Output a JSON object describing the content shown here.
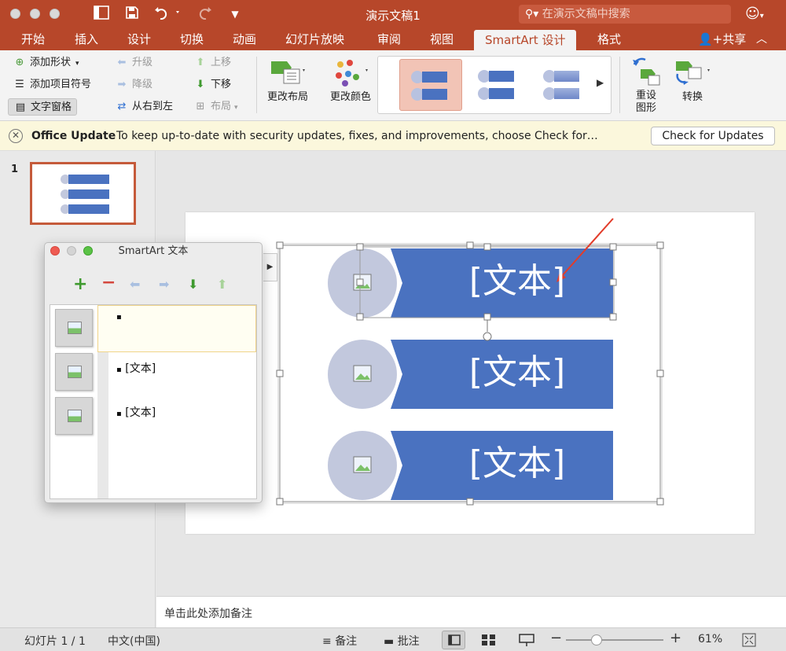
{
  "window": {
    "title": "演示文稿1",
    "search_placeholder": "在演示文稿中搜索"
  },
  "tabs": [
    {
      "label": "开始"
    },
    {
      "label": "插入"
    },
    {
      "label": "设计"
    },
    {
      "label": "切换"
    },
    {
      "label": "动画"
    },
    {
      "label": "幻灯片放映"
    },
    {
      "label": "审阅"
    },
    {
      "label": "视图"
    },
    {
      "label": "SmartArt 设计",
      "active": true
    },
    {
      "label": "格式"
    }
  ],
  "share_label": "共享",
  "ribbon": {
    "add_shape": "添加形状",
    "add_bullet": "添加项目符号",
    "text_pane": "文字窗格",
    "promote": "升级",
    "demote": "降级",
    "right_to_left": "从右到左",
    "move_up": "上移",
    "move_down": "下移",
    "layout": "布局",
    "change_layout": "更改布局",
    "change_colors": "更改颜色",
    "reset_graphic_line1": "重设",
    "reset_graphic_line2": "图形",
    "convert": "转换"
  },
  "notification": {
    "title": "Office Update",
    "message": "To keep up-to-date with security updates, fixes, and improvements, choose Check for…",
    "button": "Check for Updates"
  },
  "thumbnails": {
    "slide_number": "1"
  },
  "smartart": {
    "shapes": [
      {
        "text": "[文本]"
      },
      {
        "text": "[文本]"
      },
      {
        "text": "[文本]"
      }
    ],
    "color_fill": "#4a72c0",
    "circle_fill": "#c2c8dd"
  },
  "text_pane": {
    "title": "SmartArt 文本",
    "items": [
      {
        "bullet": "▪",
        "text": ""
      },
      {
        "bullet": "▪",
        "text": "[文本]"
      },
      {
        "bullet": "▪",
        "text": "[文本]"
      }
    ]
  },
  "notes_placeholder": "单击此处添加备注",
  "status": {
    "slide_info": "幻灯片 1 / 1",
    "language": "中文(中国)",
    "notes": "备注",
    "comments": "批注",
    "zoom": "61%"
  },
  "colors": {
    "brand": "#b7472a",
    "shape_blue": "#4a72c0"
  }
}
